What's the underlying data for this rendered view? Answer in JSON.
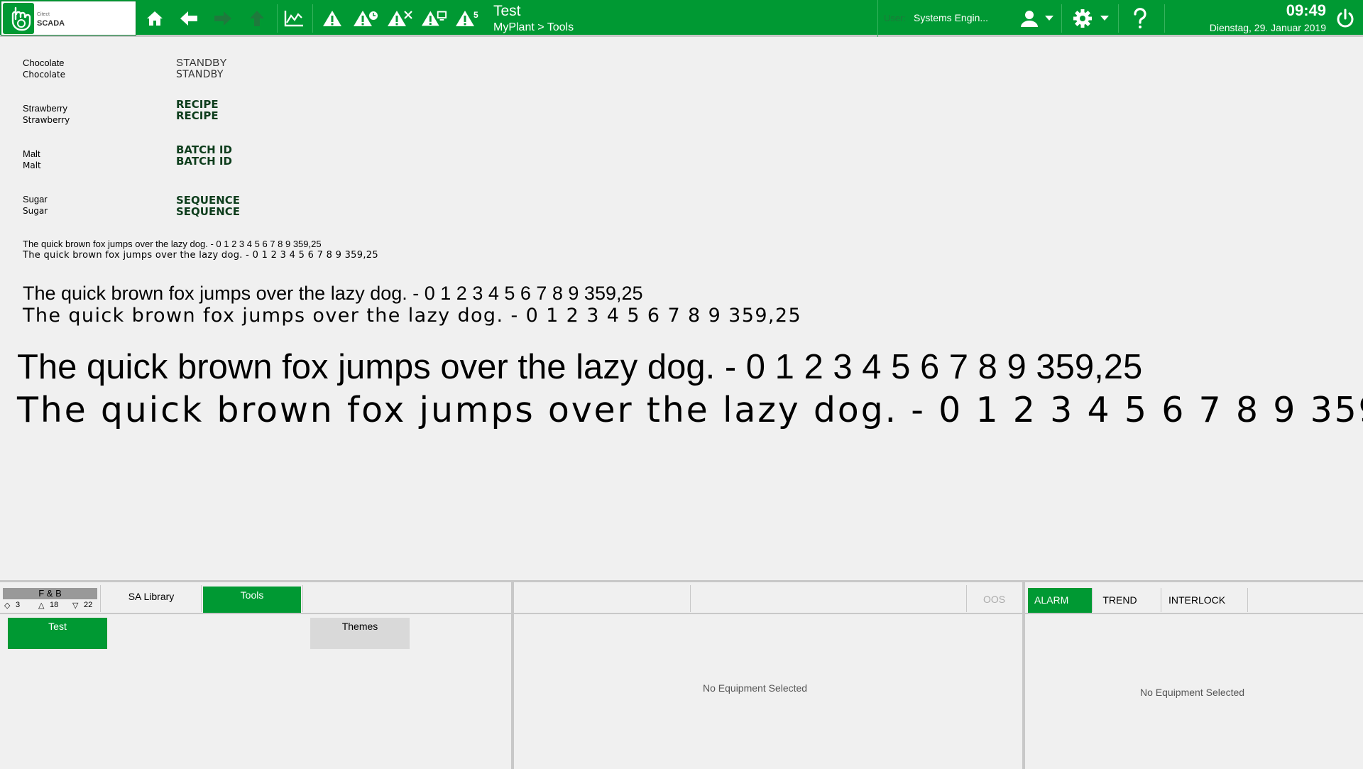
{
  "header": {
    "logo_small": "Citect",
    "logo_big": "SCADA",
    "title": "Test",
    "breadcrumb": "MyPlant > Tools",
    "user_label": "User:",
    "user_name": "Systems Engin...",
    "time": "09:49",
    "date": "Dienstag, 29. Januar 2019",
    "alarm_badge_count": "5",
    "icons": [
      "home-icon",
      "back-arrow-icon",
      "forward-arrow-icon",
      "up-arrow-icon",
      "trend-icon",
      "alarm-icon",
      "alarm-clock-icon",
      "alarm-disabled-icon",
      "alarm-hardware-icon",
      "alarm-count-icon",
      "user-icon",
      "settings-icon",
      "help-icon",
      "power-icon"
    ]
  },
  "main": {
    "rows": [
      {
        "label": "Chocolate",
        "value": "STANDBY"
      },
      {
        "label": "Strawberry",
        "value": "RECIPE"
      },
      {
        "label": "Malt",
        "value": "BATCH ID"
      },
      {
        "label": "Sugar",
        "value": "SEQUENCE"
      }
    ],
    "sample_text": "The quick brown fox jumps over the lazy dog. - 0 1 2 3 4 5 6 7 8 9 359,25"
  },
  "bottom": {
    "area_tab": "F & B",
    "counts": {
      "diamond": "3",
      "triangle_up": "18",
      "triangle_down": "22"
    },
    "tabs": [
      "SA Library",
      "Tools"
    ],
    "buttons": [
      "Test",
      "Themes"
    ],
    "oos": "OOS",
    "no_equipment": "No Equipment Selected",
    "right_tabs": [
      "ALARM",
      "TREND",
      "INTERLOCK"
    ]
  },
  "colors": {
    "accent": "#009933",
    "background": "#f0f0f0",
    "separator": "#c8c8c8"
  }
}
